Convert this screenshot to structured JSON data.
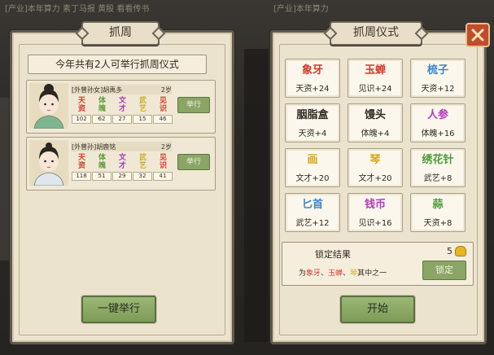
{
  "background": {
    "left_strip": "[产业]本年算力 素丁马报  黄殷  看看传书",
    "right_strip": "[产业]本年算力"
  },
  "left_panel": {
    "title": "抓周",
    "banner": "今年共有2人可举行抓周仪式",
    "children": [
      {
        "name": "[外曾孙女]胡禹多",
        "age": "2岁",
        "attrs": [
          {
            "glyph": "天资",
            "value": "102",
            "color": "#d23a2a"
          },
          {
            "glyph": "体魄",
            "value": "62",
            "color": "#5f9c3a"
          },
          {
            "glyph": "文才",
            "value": "27",
            "color": "#a23ab8"
          },
          {
            "glyph": "武艺",
            "value": "15",
            "color": "#c9b02a"
          },
          {
            "glyph": "见识",
            "value": "46",
            "color": "#d23a2a"
          }
        ],
        "button": "举行"
      },
      {
        "name": "[外曾孙]胡鹿铭",
        "age": "2岁",
        "attrs": [
          {
            "glyph": "天资",
            "value": "118",
            "color": "#d23a2a"
          },
          {
            "glyph": "体魄",
            "value": "51",
            "color": "#5f9c3a"
          },
          {
            "glyph": "文才",
            "value": "29",
            "color": "#a23ab8"
          },
          {
            "glyph": "武艺",
            "value": "32",
            "color": "#c9b02a"
          },
          {
            "glyph": "见识",
            "value": "41",
            "color": "#d23a2a"
          }
        ],
        "button": "举行"
      }
    ],
    "action_button": "一键举行"
  },
  "right_panel": {
    "title": "抓周仪式",
    "items": [
      {
        "name": "象牙",
        "effect": "天资+24",
        "color": "#d23a2a"
      },
      {
        "name": "玉蝉",
        "effect": "见识+24",
        "color": "#d23a2a"
      },
      {
        "name": "梳子",
        "effect": "天资+12",
        "color": "#3a86c9"
      },
      {
        "name": "胭脂盒",
        "effect": "天资+4",
        "color": "#2e2a22"
      },
      {
        "name": "馒头",
        "effect": "体魄+4",
        "color": "#2e2a22"
      },
      {
        "name": "人参",
        "effect": "体魄+16",
        "color": "#b23ac0"
      },
      {
        "name": "画",
        "effect": "文才+20",
        "color": "#d8a81a"
      },
      {
        "name": "琴",
        "effect": "文才+20",
        "color": "#d8a81a"
      },
      {
        "name": "绣花针",
        "effect": "武艺+8",
        "color": "#4c9a3a"
      },
      {
        "name": "匕首",
        "effect": "武艺+12",
        "color": "#3a86c9"
      },
      {
        "name": "钱币",
        "effect": "见识+16",
        "color": "#b23ac0"
      },
      {
        "name": "蒜",
        "effect": "天资+8",
        "color": "#4c9a3a"
      }
    ],
    "lock": {
      "title": "锁定结果",
      "cost": "5",
      "desc_prefix": "为",
      "options": [
        {
          "text": "象牙",
          "color": "#d23a2a"
        },
        {
          "text": "玉蝉",
          "color": "#d23a2a"
        },
        {
          "text": "琴",
          "color": "#d8a81a"
        }
      ],
      "sep": "、",
      "desc_suffix": "其中之一",
      "button": "锁定"
    },
    "start_button": "开始"
  },
  "colors": {
    "panel_bg": "#ece3cf",
    "button_green": "#8aa566",
    "close_red": "#c24a2d"
  }
}
